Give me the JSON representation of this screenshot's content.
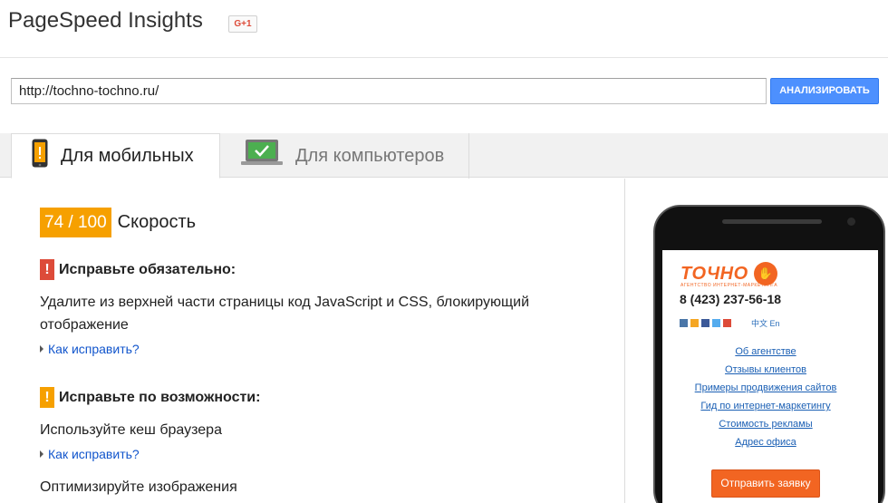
{
  "header": {
    "title": "PageSpeed Insights",
    "gplus_label": "G+1"
  },
  "search": {
    "url_value": "http://tochno-tochno.ru/",
    "analyze_label": "АНАЛИЗИРОВАТЬ"
  },
  "tabs": [
    {
      "label": "Для мобильных",
      "icon": "phone-icon",
      "active": true
    },
    {
      "label": "Для компьютеров",
      "icon": "monitor-check-icon",
      "active": false
    }
  ],
  "score": {
    "value": "74 / 100",
    "label": "Скорость",
    "color": "#f6a000"
  },
  "sections": [
    {
      "title": "Исправьте обязательно:",
      "severity": "red",
      "color": "#dd4b39",
      "rules": [
        "Удалите из верхней части страницы код JavaScript и CSS, блокирующий отображение"
      ],
      "howto": "Как исправить?"
    },
    {
      "title": "Исправьте по возможности:",
      "severity": "orange",
      "color": "#f6a000",
      "rules": [
        "Используйте кеш браузера",
        "Оптимизируйте изображения"
      ],
      "howto": "Как исправить?"
    }
  ],
  "preview": {
    "logo_text": "ТОЧНО",
    "logo_sub": "АГЕНТСТВО ИНТЕРНЕТ-МАРКЕТИНГА",
    "phone": "8 (423) 237-56-18",
    "langs": "中文 En",
    "menu": [
      "Об агентстве",
      "Отзывы клиентов",
      "Примеры продвижения сайтов",
      "Гид по интернет-маркетингу",
      "Стоимость рекламы",
      "Адрес офиса"
    ],
    "cta": "Отправить заявку",
    "accent_color": "#f26522"
  }
}
